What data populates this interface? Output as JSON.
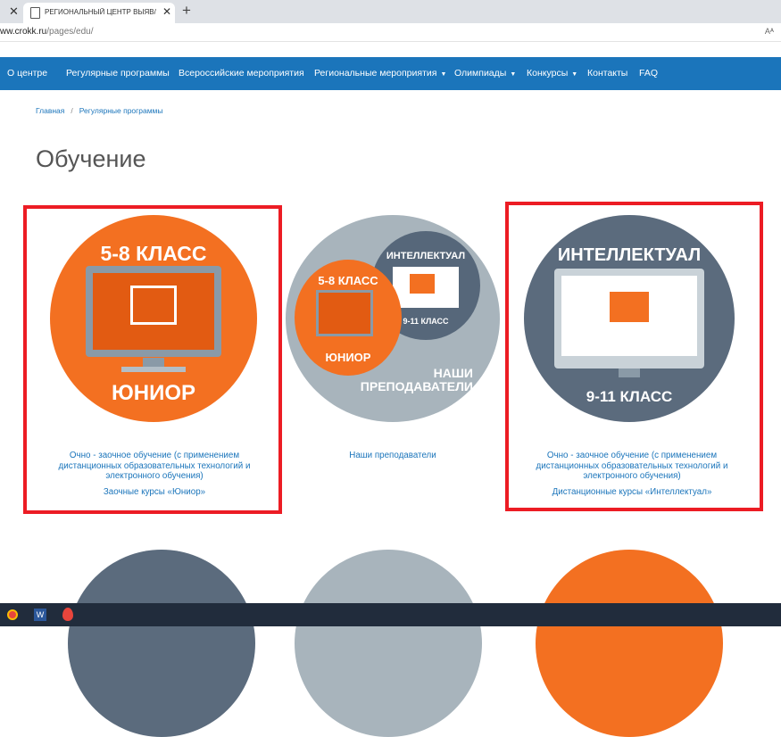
{
  "browser": {
    "tab_title": "РЕГИОНАЛЬНЫЙ ЦЕНТР ВЫЯВ/",
    "url_host": "ww.crokk.ru",
    "url_path": "/pages/edu/",
    "reader_icon": "Aᴬ"
  },
  "nav": {
    "items": [
      "О центре",
      "Регулярные программы",
      "Всероссийские мероприятия",
      "Региональные мероприятия",
      "Олимпиады",
      "Конкурсы",
      "Контакты",
      "FAQ"
    ],
    "dropdown": [
      false,
      false,
      false,
      true,
      true,
      true,
      false,
      false
    ]
  },
  "breadcrumb": {
    "home": "Главная",
    "sep": "/",
    "current": "Регулярные программы"
  },
  "page_title": "Обучение",
  "cards": [
    {
      "image_top": "5-8 КЛАСС",
      "image_bottom": "ЮНИОР",
      "desc": "Очно - заочное обучение (с применением дистанционных образовательных технологий и электронного обучения)",
      "link": "Заочные курсы «Юниор»"
    },
    {
      "image_top": "ИНТЕЛЛЕКТУАЛ",
      "image_sub": "9-11 КЛАСС",
      "image_junior_top": "5-8 КЛАСС",
      "image_junior": "ЮНИОР",
      "image_bottom": "НАШИ ПРЕПОДАВАТЕЛИ",
      "link": "Наши преподаватели"
    },
    {
      "image_top": "ИНТЕЛЛЕКТУАЛ",
      "image_bottom": "9-11 КЛАСС",
      "desc": "Очно - заочное  обучение (с применением дистанционных образовательных технологий и электронного обучения)",
      "link": "Дистанционные курсы  «Интеллектуал»"
    }
  ],
  "colors": {
    "nav": "#1b75bb",
    "orange": "#f37021",
    "slate": "#5b6b7d",
    "grey": "#a8b4bc",
    "highlight": "#ec1c24"
  },
  "taskbar": {
    "icons": [
      "chrome-icon",
      "word-icon",
      "app-drop-icon"
    ]
  }
}
